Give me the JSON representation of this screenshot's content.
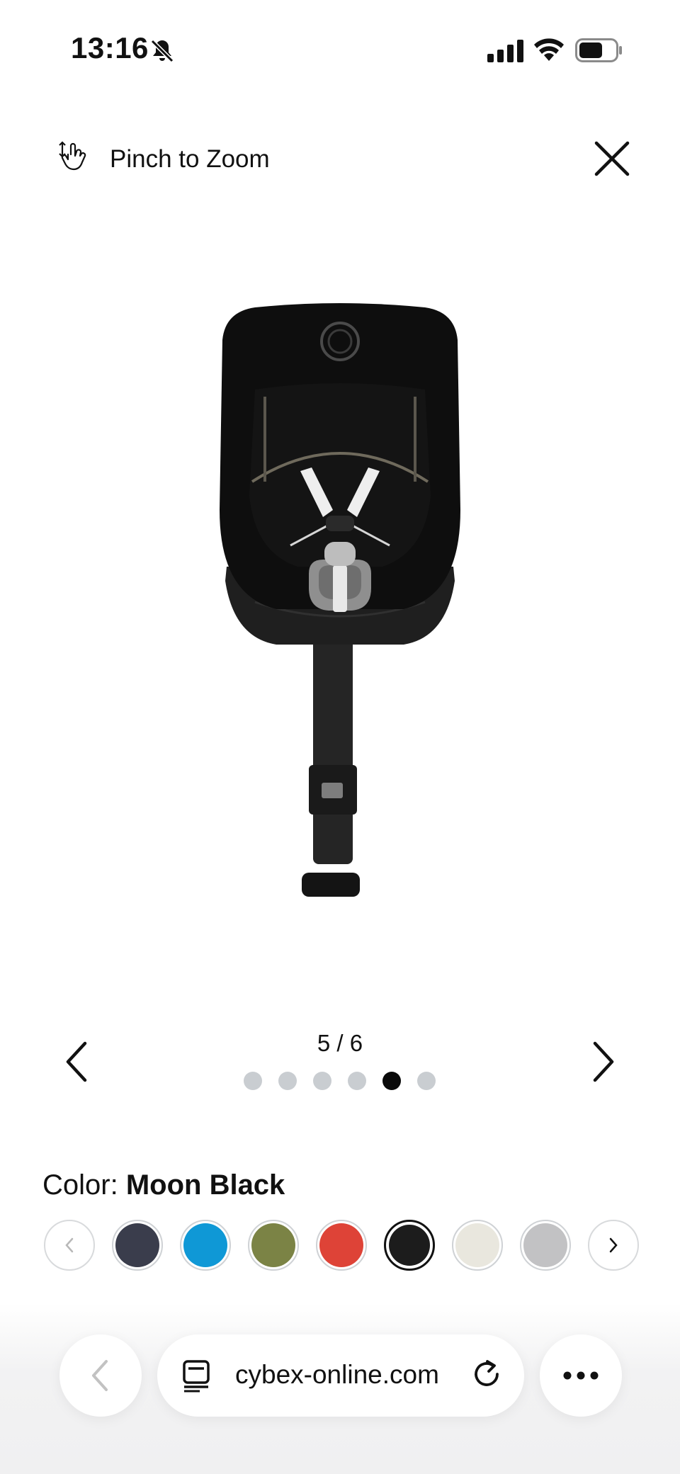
{
  "status_bar": {
    "time": "13:16",
    "icons": [
      "bell-off-icon",
      "signal-icon",
      "wifi-icon",
      "battery-icon"
    ]
  },
  "zoom_header": {
    "label": "Pinch to Zoom",
    "icon": "pinch-icon",
    "close_icon": "close-icon"
  },
  "gallery": {
    "product_image": "car-seat-moon-black",
    "counter": "5 / 6",
    "current": 5,
    "total": 6
  },
  "color": {
    "label": "Color:",
    "selected": "Moon Black",
    "swatches": [
      {
        "hex": "#3a3d4c"
      },
      {
        "hex": "#0f98d6"
      },
      {
        "hex": "#7b8345"
      },
      {
        "hex": "#de4337"
      },
      {
        "hex": "#1c1c1c"
      },
      {
        "hex": "#e9e7de"
      },
      {
        "hex": "#c2c2c4"
      }
    ]
  },
  "browser": {
    "url": "cybex-online.com",
    "icons": [
      "back-icon",
      "reader-icon",
      "reload-icon",
      "more-icon"
    ]
  }
}
